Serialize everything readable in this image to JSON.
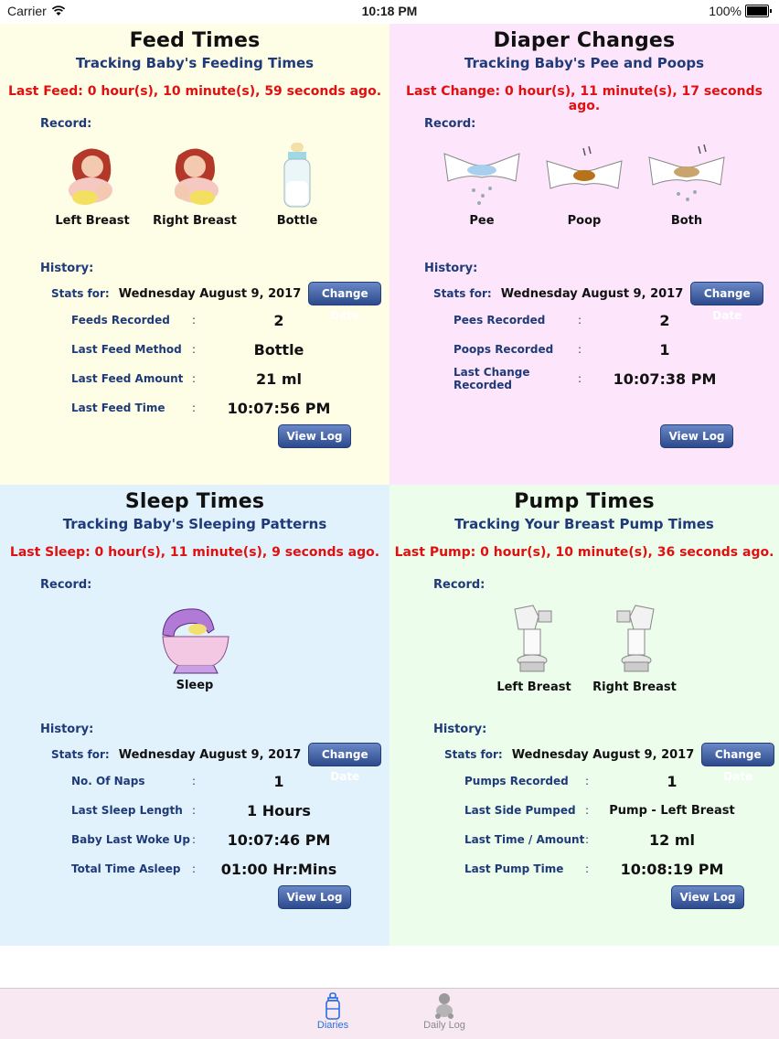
{
  "status": {
    "carrier": "Carrier",
    "time": "10:18 PM",
    "battery": "100%"
  },
  "feed": {
    "title": "Feed Times",
    "subtitle": "Tracking Baby's Feeding Times",
    "last": "Last Feed: 0 hour(s), 10 minute(s), 59 seconds ago.",
    "record_label": "Record:",
    "icons": [
      "Left Breast",
      "Right Breast",
      "Bottle"
    ],
    "history_label": "History:",
    "stats_for": "Stats for:",
    "date": "Wednesday August 9, 2017",
    "change_date": "Change Date",
    "rows": [
      {
        "k": "Feeds Recorded",
        "v": "2"
      },
      {
        "k": "Last Feed Method",
        "v": "Bottle"
      },
      {
        "k": "Last Feed Amount",
        "v": "21 ml"
      },
      {
        "k": "Last Feed Time",
        "v": "10:07:56 PM"
      }
    ],
    "view_log": "View Log"
  },
  "diaper": {
    "title": "Diaper Changes",
    "subtitle": "Tracking Baby's Pee and Poops",
    "last": "Last Change: 0 hour(s), 11 minute(s), 17 seconds ago.",
    "record_label": "Record:",
    "icons": [
      "Pee",
      "Poop",
      "Both"
    ],
    "history_label": "History:",
    "stats_for": "Stats for:",
    "date": "Wednesday August 9, 2017",
    "change_date": "Change Date",
    "rows": [
      {
        "k": "Pees Recorded",
        "v": "2"
      },
      {
        "k": "Poops Recorded",
        "v": "1"
      },
      {
        "k": "Last Change Recorded",
        "v": "10:07:38 PM"
      }
    ],
    "view_log": "View Log"
  },
  "sleep": {
    "title": "Sleep Times",
    "subtitle": "Tracking Baby's Sleeping Patterns",
    "last": "Last Sleep: 0 hour(s), 11 minute(s), 9 seconds ago.",
    "record_label": "Record:",
    "icons": [
      "Sleep"
    ],
    "history_label": "History:",
    "stats_for": "Stats for:",
    "date": "Wednesday August 9, 2017",
    "change_date": "Change Date",
    "rows": [
      {
        "k": "No. Of Naps",
        "v": "1"
      },
      {
        "k": "Last Sleep Length",
        "v": "1 Hours"
      },
      {
        "k": "Baby Last Woke Up",
        "v": "10:07:46 PM"
      },
      {
        "k": "Total Time Asleep",
        "v": "01:00 Hr:Mins"
      }
    ],
    "view_log": "View Log"
  },
  "pump": {
    "title": "Pump Times",
    "subtitle": "Tracking Your Breast Pump Times",
    "last": "Last Pump: 0 hour(s), 10 minute(s), 36 seconds ago.",
    "record_label": "Record:",
    "icons": [
      "Left Breast",
      "Right Breast"
    ],
    "history_label": "History:",
    "stats_for": "Stats for:",
    "date": "Wednesday August 9, 2017",
    "change_date": "Change Date",
    "rows": [
      {
        "k": "Pumps Recorded",
        "v": "1"
      },
      {
        "k": "Last Side Pumped",
        "v": "Pump - Left Breast"
      },
      {
        "k": "Last Time / Amount",
        "v": "12 ml"
      },
      {
        "k": "Last Pump Time",
        "v": "10:08:19 PM"
      }
    ],
    "view_log": "View Log"
  },
  "tabs": [
    {
      "label": "Diaries",
      "icon": "bottle-icon",
      "active": true
    },
    {
      "label": "Daily Log",
      "icon": "baby-icon",
      "active": false
    }
  ],
  "colors": {
    "accent": "#2a6ede",
    "alert": "#e01010",
    "label": "#1f3a78"
  }
}
